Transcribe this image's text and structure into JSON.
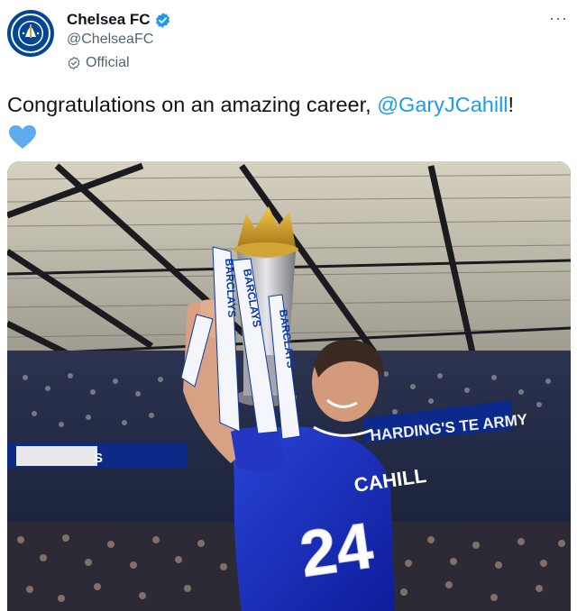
{
  "account": {
    "display_name": "Chelsea FC",
    "handle": "@ChelseaFC",
    "label": "Official",
    "avatar_icon": "chelsea-crest-icon",
    "verified_icon": "verified-badge-icon",
    "brand_color": "#034694",
    "verified_color": "#1d9bf0"
  },
  "menu": {
    "more_label": "···"
  },
  "tweet": {
    "text": "Congratulations on an amazing career, ",
    "mention": "@GaryJCahill",
    "suffix": "!",
    "emoji": "blue-heart-icon",
    "mention_color": "#1d9bf0"
  },
  "media": {
    "trophy_ribbon_text": "BARCLAYS",
    "stand_banner_text": "HARDING'S TE ARMY",
    "left_banner_text": "S",
    "shirt_name": "CAHILL",
    "shirt_number": "24"
  }
}
